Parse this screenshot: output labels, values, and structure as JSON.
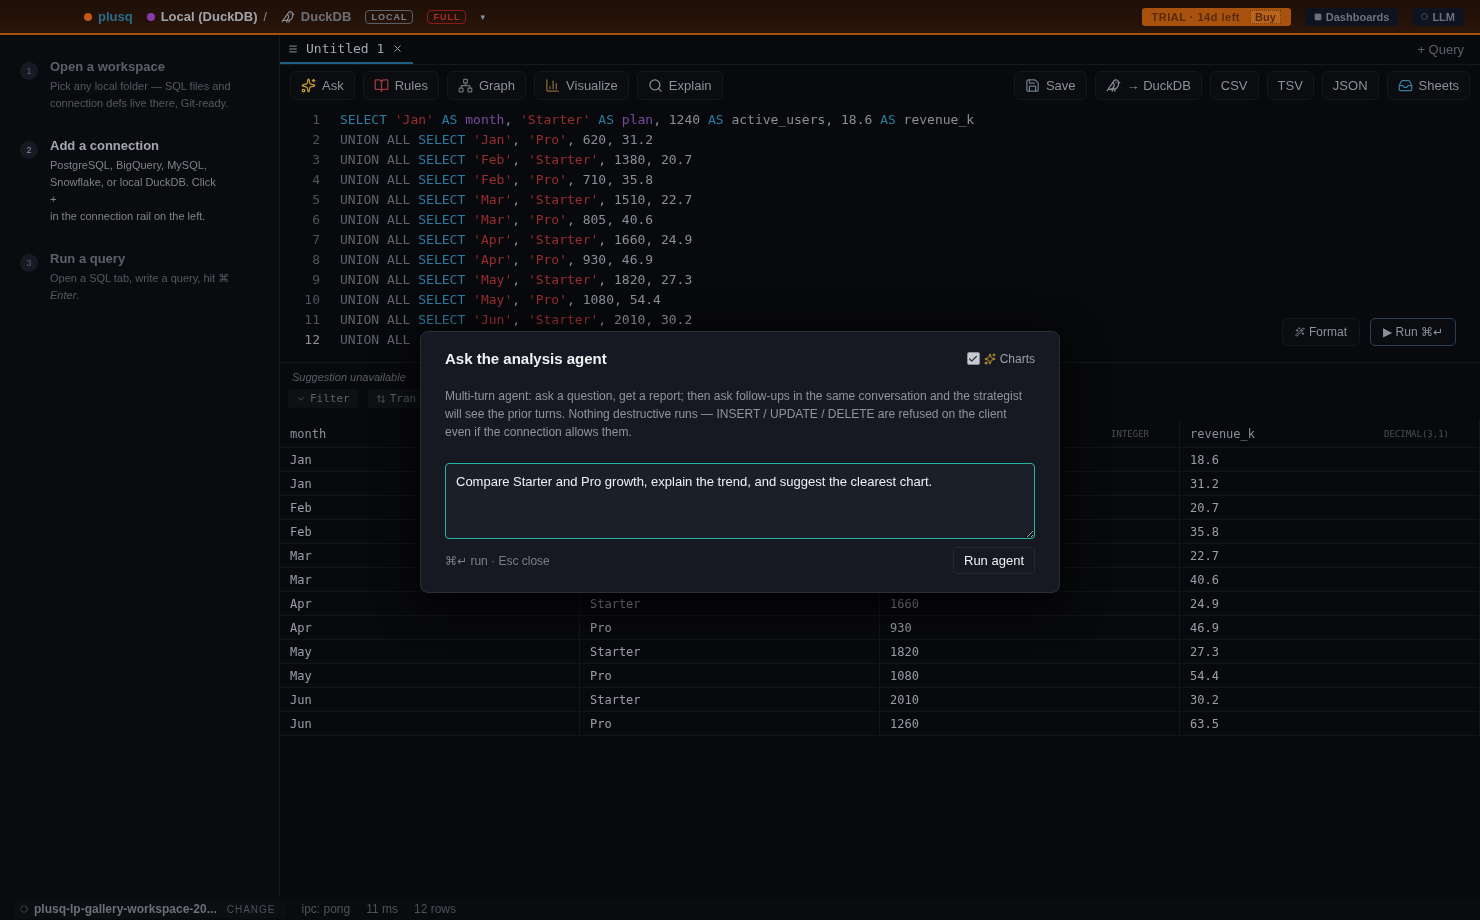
{
  "topbar": {
    "brand": "plusq",
    "connection": "Local (DuckDB)",
    "separator": "/",
    "engine": "DuckDB",
    "badges": [
      {
        "label": "LOCAL",
        "kind": "neutral"
      },
      {
        "label": "FULL",
        "kind": "danger"
      }
    ],
    "caret": "▾",
    "trial": "TRIAL · 14d left",
    "buy": "Buy",
    "dashboards": "Dashboards",
    "llm": "LLM"
  },
  "sidebar": {
    "steps": [
      {
        "number": "1",
        "title": "Open a workspace",
        "lines": [
          "Pick any local folder — SQL files and connection defs live there, Git-ready."
        ],
        "active": false
      },
      {
        "number": "2",
        "title": "Add a connection",
        "lines": [
          "PostgreSQL, BigQuery, MySQL, Snowflake, or local DuckDB. Click",
          "+",
          "in the connection rail on the left."
        ],
        "active": true
      },
      {
        "number": "3",
        "title": "Run a query",
        "lines": [
          "Open a SQL tab, write a query, hit ⌘ *Enter*."
        ],
        "active": false
      }
    ]
  },
  "tabs": [
    {
      "label": "Untitled 1",
      "selected": true
    }
  ],
  "new_query": "+ Query",
  "toolbar": {
    "left": [
      "Ask",
      "Rules",
      "Graph",
      "Visualize",
      "Explain"
    ],
    "right": [
      "Save",
      "→ DuckDB",
      "CSV",
      "TSV",
      "JSON",
      "Sheets"
    ]
  },
  "editor": {
    "lines": [
      {
        "number": "1",
        "tokens": [
          {
            "kind": "kw",
            "text": "SELECT "
          },
          {
            "kind": "str",
            "text": "'Jan'"
          },
          {
            "kind": "kw",
            "text": " AS "
          },
          {
            "kind": "alias",
            "text": "month"
          },
          {
            "kind": "plain",
            "text": ", "
          },
          {
            "kind": "str",
            "text": "'Starter'"
          },
          {
            "kind": "kw",
            "text": " AS "
          },
          {
            "kind": "alias",
            "text": "plan"
          },
          {
            "kind": "plain",
            "text": ", 1240 "
          },
          {
            "kind": "kw",
            "text": "AS"
          },
          {
            "kind": "plain",
            "text": " active_users, 18.6 "
          },
          {
            "kind": "kw",
            "text": "AS"
          },
          {
            "kind": "plain",
            "text": " revenue_k"
          }
        ]
      },
      {
        "number": "2",
        "tokens": [
          {
            "kind": "dim",
            "text": "UNION ALL "
          },
          {
            "kind": "kw",
            "text": "SELECT "
          },
          {
            "kind": "str",
            "text": "'Jan'"
          },
          {
            "kind": "plain",
            "text": ", "
          },
          {
            "kind": "str",
            "text": "'Pro'"
          },
          {
            "kind": "plain",
            "text": ", 620, 31.2"
          }
        ]
      },
      {
        "number": "3",
        "tokens": [
          {
            "kind": "dim",
            "text": "UNION ALL "
          },
          {
            "kind": "kw",
            "text": "SELECT "
          },
          {
            "kind": "str",
            "text": "'Feb'"
          },
          {
            "kind": "plain",
            "text": ", "
          },
          {
            "kind": "str",
            "text": "'Starter'"
          },
          {
            "kind": "plain",
            "text": ", 1380, 20.7"
          }
        ]
      },
      {
        "number": "4",
        "tokens": [
          {
            "kind": "dim",
            "text": "UNION ALL "
          },
          {
            "kind": "kw",
            "text": "SELECT "
          },
          {
            "kind": "str",
            "text": "'Feb'"
          },
          {
            "kind": "plain",
            "text": ", "
          },
          {
            "kind": "str",
            "text": "'Pro'"
          },
          {
            "kind": "plain",
            "text": ", 710, 35.8"
          }
        ]
      },
      {
        "number": "5",
        "tokens": [
          {
            "kind": "dim",
            "text": "UNION ALL "
          },
          {
            "kind": "kw",
            "text": "SELECT "
          },
          {
            "kind": "str",
            "text": "'Mar'"
          },
          {
            "kind": "plain",
            "text": ", "
          },
          {
            "kind": "str",
            "text": "'Starter'"
          },
          {
            "kind": "plain",
            "text": ", 1510, 22.7"
          }
        ]
      },
      {
        "number": "6",
        "tokens": [
          {
            "kind": "dim",
            "text": "UNION ALL "
          },
          {
            "kind": "kw",
            "text": "SELECT "
          },
          {
            "kind": "str",
            "text": "'Mar'"
          },
          {
            "kind": "plain",
            "text": ", "
          },
          {
            "kind": "str",
            "text": "'Pro'"
          },
          {
            "kind": "plain",
            "text": ", 805, 40.6"
          }
        ]
      },
      {
        "number": "7",
        "tokens": [
          {
            "kind": "dim",
            "text": "UNION ALL "
          },
          {
            "kind": "kw",
            "text": "SELECT "
          },
          {
            "kind": "str",
            "text": "'Apr'"
          },
          {
            "kind": "plain",
            "text": ", "
          },
          {
            "kind": "str",
            "text": "'Starter'"
          },
          {
            "kind": "plain",
            "text": ", 1660, 24.9"
          }
        ]
      },
      {
        "number": "8",
        "tokens": [
          {
            "kind": "dim",
            "text": "UNION ALL "
          },
          {
            "kind": "kw",
            "text": "SELECT "
          },
          {
            "kind": "str",
            "text": "'Apr'"
          },
          {
            "kind": "plain",
            "text": ", "
          },
          {
            "kind": "str",
            "text": "'Pro'"
          },
          {
            "kind": "plain",
            "text": ", 930, 46.9"
          }
        ]
      },
      {
        "number": "9",
        "tokens": [
          {
            "kind": "dim",
            "text": "UNION ALL "
          },
          {
            "kind": "kw",
            "text": "SELECT "
          },
          {
            "kind": "str",
            "text": "'May'"
          },
          {
            "kind": "plain",
            "text": ", "
          },
          {
            "kind": "str",
            "text": "'Starter'"
          },
          {
            "kind": "plain",
            "text": ", 1820, 27.3"
          }
        ]
      },
      {
        "number": "10",
        "tokens": [
          {
            "kind": "dim",
            "text": "UNION ALL "
          },
          {
            "kind": "kw",
            "text": "SELECT "
          },
          {
            "kind": "str",
            "text": "'May'"
          },
          {
            "kind": "plain",
            "text": ", "
          },
          {
            "kind": "str",
            "text": "'Pro'"
          },
          {
            "kind": "plain",
            "text": ", 1080, 54.4"
          }
        ]
      },
      {
        "number": "11",
        "tokens": [
          {
            "kind": "dim",
            "text": "UNION ALL "
          },
          {
            "kind": "kw",
            "text": "SELECT "
          },
          {
            "kind": "str",
            "text": "'Jun'"
          },
          {
            "kind": "plain",
            "text": ", "
          },
          {
            "kind": "str",
            "text": "'Starter'"
          },
          {
            "kind": "plain",
            "text": ", 2010, 30.2"
          }
        ]
      },
      {
        "number": "12",
        "tokens": [
          {
            "kind": "dim",
            "text": "UNION ALL"
          }
        ]
      }
    ],
    "format": "Format",
    "run": "▶ Run ⌘↵"
  },
  "suggestion": "Suggestion unavailable",
  "filters": [
    "Filter",
    "Tran"
  ],
  "table": {
    "columns": [
      {
        "name": "month"
      },
      {
        "type": "INTEGER"
      },
      {
        "name": "revenue_k",
        "type": "DECIMAL(3,1)"
      }
    ],
    "rows": [
      {
        "month": "Jan",
        "revenue_k": "18.6"
      },
      {
        "month": "Jan",
        "revenue_k": "31.2"
      },
      {
        "month": "Feb",
        "revenue_k": "20.7"
      },
      {
        "month": "Feb",
        "revenue_k": "35.8"
      },
      {
        "month": "Mar",
        "revenue_k": "22.7"
      },
      {
        "month": "Mar",
        "revenue_k": "40.6"
      },
      {
        "month": "Apr",
        "plan": "Starter",
        "active_users": "1660",
        "revenue_k": "24.9"
      },
      {
        "month": "Apr",
        "plan": "Pro",
        "active_users": "930",
        "revenue_k": "46.9"
      },
      {
        "month": "May",
        "plan": "Starter",
        "active_users": "1820",
        "revenue_k": "27.3"
      },
      {
        "month": "May",
        "plan": "Pro",
        "active_users": "1080",
        "revenue_k": "54.4"
      },
      {
        "month": "Jun",
        "plan": "Starter",
        "active_users": "2010",
        "revenue_k": "30.2"
      },
      {
        "month": "Jun",
        "plan": "Pro",
        "active_users": "1260",
        "revenue_k": "63.5"
      }
    ]
  },
  "status_bar": {
    "workspace": "plusq-lp-gallery-workspace-20...",
    "change": "CHANGE",
    "items": [
      "ipc: pong",
      "11 ms",
      "12 rows"
    ]
  },
  "modal": {
    "title": "Ask the analysis agent",
    "charts": {
      "label": "Charts",
      "checked": true
    },
    "description": "Multi-turn agent: ask a question, get a report; then ask follow-ups in the same conversation and the strategist will see the prior turns. Nothing destructive runs — INSERT / UPDATE / DELETE are refused on the client even if the connection allows them.",
    "prompt": "Compare Starter and Pro growth, explain the trend, and suggest the clearest chart.",
    "hint": "⌘↵ run · Esc close",
    "run": "Run agent"
  }
}
